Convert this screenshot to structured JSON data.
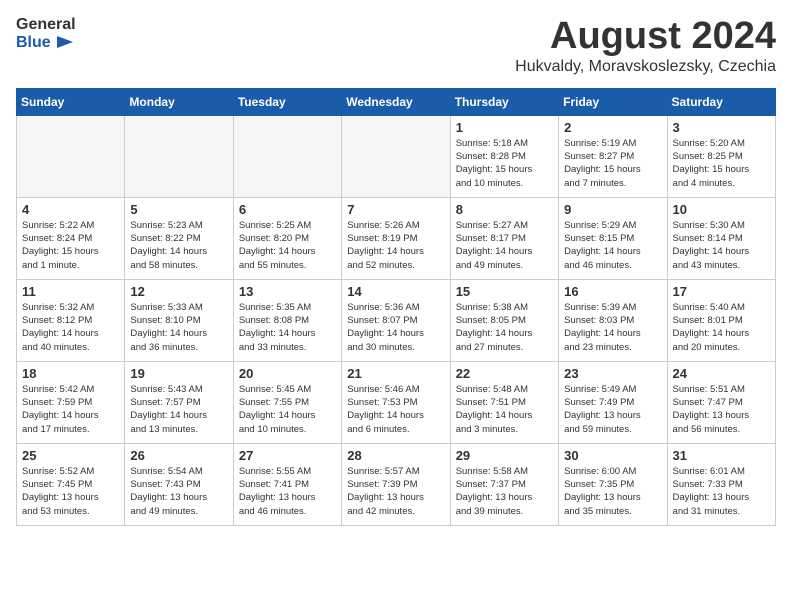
{
  "logo": {
    "general": "General",
    "blue": "Blue"
  },
  "title": "August 2024",
  "location": "Hukvaldy, Moravskoslezsky, Czechia",
  "weekdays": [
    "Sunday",
    "Monday",
    "Tuesday",
    "Wednesday",
    "Thursday",
    "Friday",
    "Saturday"
  ],
  "weeks": [
    [
      {
        "day": "",
        "info": ""
      },
      {
        "day": "",
        "info": ""
      },
      {
        "day": "",
        "info": ""
      },
      {
        "day": "",
        "info": ""
      },
      {
        "day": "1",
        "info": "Sunrise: 5:18 AM\nSunset: 8:28 PM\nDaylight: 15 hours\nand 10 minutes."
      },
      {
        "day": "2",
        "info": "Sunrise: 5:19 AM\nSunset: 8:27 PM\nDaylight: 15 hours\nand 7 minutes."
      },
      {
        "day": "3",
        "info": "Sunrise: 5:20 AM\nSunset: 8:25 PM\nDaylight: 15 hours\nand 4 minutes."
      }
    ],
    [
      {
        "day": "4",
        "info": "Sunrise: 5:22 AM\nSunset: 8:24 PM\nDaylight: 15 hours\nand 1 minute."
      },
      {
        "day": "5",
        "info": "Sunrise: 5:23 AM\nSunset: 8:22 PM\nDaylight: 14 hours\nand 58 minutes."
      },
      {
        "day": "6",
        "info": "Sunrise: 5:25 AM\nSunset: 8:20 PM\nDaylight: 14 hours\nand 55 minutes."
      },
      {
        "day": "7",
        "info": "Sunrise: 5:26 AM\nSunset: 8:19 PM\nDaylight: 14 hours\nand 52 minutes."
      },
      {
        "day": "8",
        "info": "Sunrise: 5:27 AM\nSunset: 8:17 PM\nDaylight: 14 hours\nand 49 minutes."
      },
      {
        "day": "9",
        "info": "Sunrise: 5:29 AM\nSunset: 8:15 PM\nDaylight: 14 hours\nand 46 minutes."
      },
      {
        "day": "10",
        "info": "Sunrise: 5:30 AM\nSunset: 8:14 PM\nDaylight: 14 hours\nand 43 minutes."
      }
    ],
    [
      {
        "day": "11",
        "info": "Sunrise: 5:32 AM\nSunset: 8:12 PM\nDaylight: 14 hours\nand 40 minutes."
      },
      {
        "day": "12",
        "info": "Sunrise: 5:33 AM\nSunset: 8:10 PM\nDaylight: 14 hours\nand 36 minutes."
      },
      {
        "day": "13",
        "info": "Sunrise: 5:35 AM\nSunset: 8:08 PM\nDaylight: 14 hours\nand 33 minutes."
      },
      {
        "day": "14",
        "info": "Sunrise: 5:36 AM\nSunset: 8:07 PM\nDaylight: 14 hours\nand 30 minutes."
      },
      {
        "day": "15",
        "info": "Sunrise: 5:38 AM\nSunset: 8:05 PM\nDaylight: 14 hours\nand 27 minutes."
      },
      {
        "day": "16",
        "info": "Sunrise: 5:39 AM\nSunset: 8:03 PM\nDaylight: 14 hours\nand 23 minutes."
      },
      {
        "day": "17",
        "info": "Sunrise: 5:40 AM\nSunset: 8:01 PM\nDaylight: 14 hours\nand 20 minutes."
      }
    ],
    [
      {
        "day": "18",
        "info": "Sunrise: 5:42 AM\nSunset: 7:59 PM\nDaylight: 14 hours\nand 17 minutes."
      },
      {
        "day": "19",
        "info": "Sunrise: 5:43 AM\nSunset: 7:57 PM\nDaylight: 14 hours\nand 13 minutes."
      },
      {
        "day": "20",
        "info": "Sunrise: 5:45 AM\nSunset: 7:55 PM\nDaylight: 14 hours\nand 10 minutes."
      },
      {
        "day": "21",
        "info": "Sunrise: 5:46 AM\nSunset: 7:53 PM\nDaylight: 14 hours\nand 6 minutes."
      },
      {
        "day": "22",
        "info": "Sunrise: 5:48 AM\nSunset: 7:51 PM\nDaylight: 14 hours\nand 3 minutes."
      },
      {
        "day": "23",
        "info": "Sunrise: 5:49 AM\nSunset: 7:49 PM\nDaylight: 13 hours\nand 59 minutes."
      },
      {
        "day": "24",
        "info": "Sunrise: 5:51 AM\nSunset: 7:47 PM\nDaylight: 13 hours\nand 56 minutes."
      }
    ],
    [
      {
        "day": "25",
        "info": "Sunrise: 5:52 AM\nSunset: 7:45 PM\nDaylight: 13 hours\nand 53 minutes."
      },
      {
        "day": "26",
        "info": "Sunrise: 5:54 AM\nSunset: 7:43 PM\nDaylight: 13 hours\nand 49 minutes."
      },
      {
        "day": "27",
        "info": "Sunrise: 5:55 AM\nSunset: 7:41 PM\nDaylight: 13 hours\nand 46 minutes."
      },
      {
        "day": "28",
        "info": "Sunrise: 5:57 AM\nSunset: 7:39 PM\nDaylight: 13 hours\nand 42 minutes."
      },
      {
        "day": "29",
        "info": "Sunrise: 5:58 AM\nSunset: 7:37 PM\nDaylight: 13 hours\nand 39 minutes."
      },
      {
        "day": "30",
        "info": "Sunrise: 6:00 AM\nSunset: 7:35 PM\nDaylight: 13 hours\nand 35 minutes."
      },
      {
        "day": "31",
        "info": "Sunrise: 6:01 AM\nSunset: 7:33 PM\nDaylight: 13 hours\nand 31 minutes."
      }
    ]
  ]
}
